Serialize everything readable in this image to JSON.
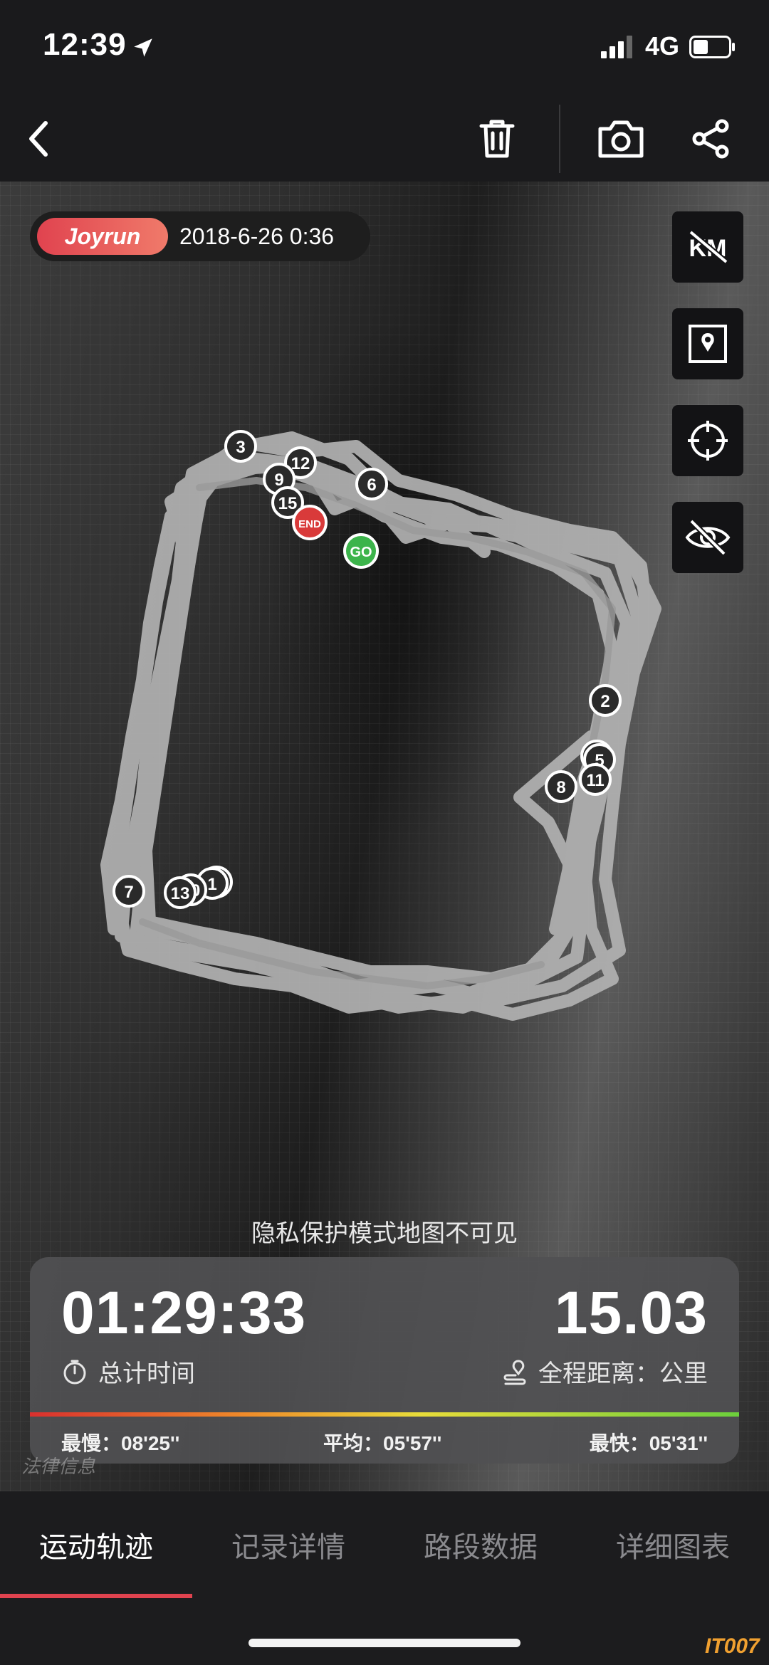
{
  "status_bar": {
    "time": "12:39",
    "network": "4G"
  },
  "nav": {
    "back_icon": "chevron-left-icon",
    "delete_icon": "trash-icon",
    "camera_icon": "camera-icon",
    "share_icon": "share-icon"
  },
  "map": {
    "brand_logo": "Joyrun",
    "run_datetime": "2018-6-26 0:36",
    "tools": [
      {
        "name": "km-markers-toggle",
        "icon": "km-off-icon",
        "label": "KM"
      },
      {
        "name": "map-style-toggle",
        "icon": "map-pin-icon"
      },
      {
        "name": "recenter",
        "icon": "crosshair-icon"
      },
      {
        "name": "privacy-toggle",
        "icon": "eye-off-icon"
      }
    ],
    "start_label": "GO",
    "end_label": "END",
    "km_markers": [
      "1",
      "2",
      "3",
      "5",
      "6",
      "7",
      "8",
      "9",
      "10",
      "11",
      "12",
      "13",
      "15"
    ],
    "privacy_note": "隐私保护模式地图不可见"
  },
  "stats": {
    "duration": "01:29:33",
    "duration_label": "总计时间",
    "distance": "15.03",
    "distance_label": "全程距离：公里",
    "pace_slowest_label": "最慢：",
    "pace_slowest": "08'25''",
    "pace_average_label": "平均：",
    "pace_average": "05'57''",
    "pace_fastest_label": "最快：",
    "pace_fastest": "05'31''"
  },
  "watermark": "法律信息",
  "tabs": [
    {
      "label": "运动轨迹",
      "active": true
    },
    {
      "label": "记录详情",
      "active": false
    },
    {
      "label": "路段数据",
      "active": false
    },
    {
      "label": "详细图表",
      "active": false
    }
  ],
  "site_badge": "IT007",
  "colors": {
    "accent": "#e0434f",
    "start_marker": "#3cb44b",
    "end_marker": "#d93a3a",
    "route": "#b4b4b4"
  }
}
